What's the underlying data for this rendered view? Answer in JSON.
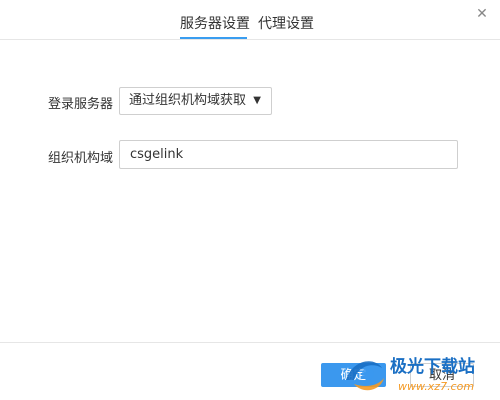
{
  "tabs": [
    {
      "label": "服务器设置",
      "active": true
    },
    {
      "label": "代理设置",
      "active": false
    }
  ],
  "close_icon": "close-icon",
  "form": {
    "login_server_label": "登录服务器",
    "login_server_value": "通过组织机构域获取",
    "org_domain_label": "组织机构域",
    "org_domain_value": "csgelink"
  },
  "footer": {
    "ok_label": "确定",
    "cancel_label": "取消"
  },
  "watermark": {
    "text": "极光下载站",
    "url": "www.xz7.com"
  },
  "colors": {
    "accent": "#3b98ee",
    "tab_underline": "#3a9df0",
    "watermark_blue": "#1a6fc4",
    "watermark_orange": "#f59a23"
  }
}
